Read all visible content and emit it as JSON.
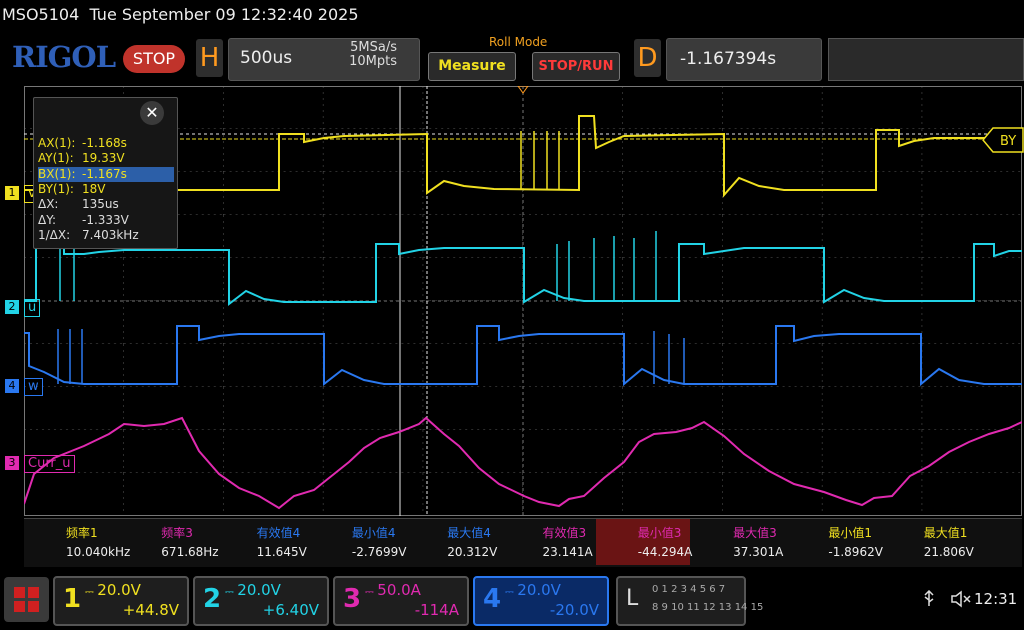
{
  "status": {
    "model": "MSO5104",
    "datetime": "Tue September 09 12:32:40 2025"
  },
  "brand": {
    "logo": "RIGOL",
    "run_state": "STOP"
  },
  "horizontal": {
    "letter": "H",
    "timebase": "500us",
    "sample_rate": "5MSa/s",
    "memory_depth": "10Mpts",
    "mode": "Roll Mode"
  },
  "buttons": {
    "measure": "Measure",
    "stop_run": "STOP/RUN"
  },
  "delay": {
    "letter": "D",
    "value": "-1.167394s"
  },
  "cursor": {
    "close_glyph": "✕",
    "rows": [
      {
        "key": "AX(1):",
        "value": "-1.168s",
        "color": "#f0e020"
      },
      {
        "key": "AY(1):",
        "value": "19.33V",
        "color": "#f0e020"
      },
      {
        "key": "BX(1):",
        "value": "-1.167s",
        "color": "#f0e020",
        "selected": true
      },
      {
        "key": "BY(1):",
        "value": "18V",
        "color": "#f0e020"
      },
      {
        "key": "ΔX:",
        "value": "135us",
        "color": "#dddddd"
      },
      {
        "key": "ΔY:",
        "value": "-1.333V",
        "color": "#dddddd"
      },
      {
        "key": "1/ΔX:",
        "value": "7.403kHz",
        "color": "#dddddd"
      }
    ],
    "by_marker": "BY"
  },
  "channels": {
    "ch1": {
      "num": "1",
      "label": "v",
      "color": "#f0e020"
    },
    "ch2": {
      "num": "2",
      "label": "u",
      "color": "#22d3e6"
    },
    "ch4": {
      "num": "4",
      "label": "w",
      "color": "#2a78f0"
    },
    "ch3": {
      "num": "3",
      "label": "Curr_u",
      "color": "#e02ab0"
    }
  },
  "measurements": [
    {
      "label": "频率1",
      "value": "10.040kHz",
      "color": "#f0e020"
    },
    {
      "label": "频率3",
      "value": "671.68Hz",
      "color": "#e02ab0"
    },
    {
      "label": "有效值4",
      "value": "11.645V",
      "color": "#2a78f0"
    },
    {
      "label": "最小值4",
      "value": "-2.7699V",
      "color": "#2a78f0"
    },
    {
      "label": "最大值4",
      "value": "20.312V",
      "color": "#2a78f0"
    },
    {
      "label": "有效值3",
      "value": "23.141A",
      "color": "#e02ab0"
    },
    {
      "label": "最小值3",
      "value": "-44.294A",
      "color": "#e02ab0",
      "highlight": true
    },
    {
      "label": "最大值3",
      "value": "37.301A",
      "color": "#e02ab0"
    },
    {
      "label": "最小值1",
      "value": "-1.8962V",
      "color": "#f0e020"
    },
    {
      "label": "最大值1",
      "value": "21.806V",
      "color": "#f0e020"
    }
  ],
  "channel_settings": [
    {
      "num": "1",
      "scale": "20.0V",
      "offset": "+44.8V",
      "color": "#f0e020"
    },
    {
      "num": "2",
      "scale": "20.0V",
      "offset": "+6.40V",
      "color": "#22d3e6"
    },
    {
      "num": "3",
      "scale": "50.0A",
      "offset": "-114A",
      "color": "#e02ab0"
    },
    {
      "num": "4",
      "scale": "20.0V",
      "offset": "-20.0V",
      "color": "#2a78f0"
    }
  ],
  "logic": {
    "letter": "L",
    "row1": "0 1 2 3  4 5 6 7",
    "row2": "8 9 10 11 12 13 14 15"
  },
  "tray": {
    "clock": "12:31"
  }
}
